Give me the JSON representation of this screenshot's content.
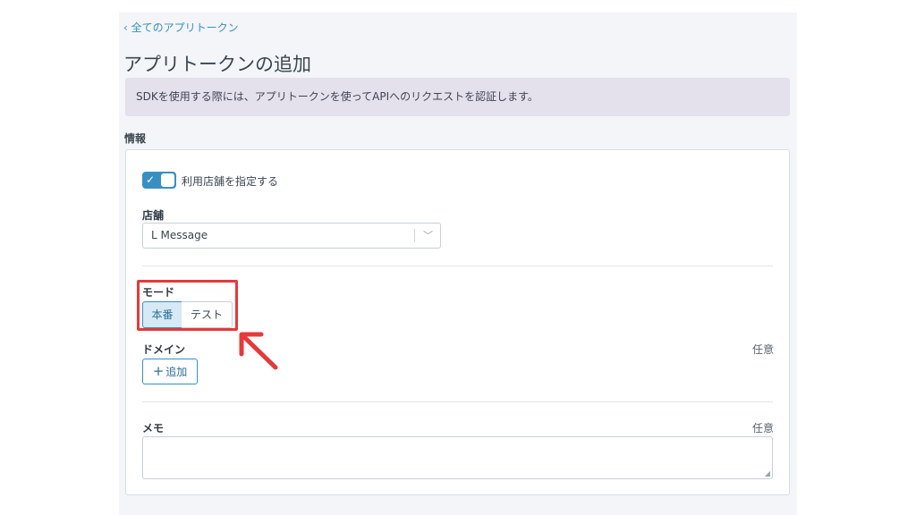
{
  "breadcrumb": {
    "back_label": "‹ 全てのアプリトークン"
  },
  "page": {
    "title": "アプリトークンの追加"
  },
  "notice": {
    "text": "SDKを使用する際には、アプリトークンを使ってAPIへのリクエストを認証します。"
  },
  "section": {
    "label": "情報"
  },
  "store_toggle": {
    "label": "利用店舗を指定する",
    "checked": true
  },
  "store": {
    "label": "店舗",
    "selected": "L Message"
  },
  "mode": {
    "label": "モード",
    "options": [
      "本番",
      "テスト"
    ],
    "selected": "本番"
  },
  "domain": {
    "label": "ドメイン",
    "optional": "任意",
    "add_button": "追加"
  },
  "memo": {
    "label": "メモ",
    "optional": "任意",
    "value": ""
  },
  "colors": {
    "accent": "#3a8fc2",
    "annotation": "#e5393b",
    "notice_bg": "#e4e0ec"
  },
  "icons": {
    "toggle": "check-icon",
    "select": "chevron-down-icon",
    "add": "plus-icon"
  }
}
